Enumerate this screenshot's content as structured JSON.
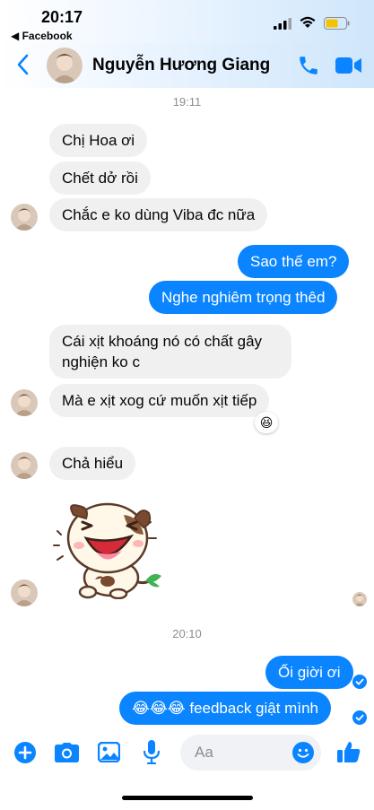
{
  "status_bar": {
    "time": "20:17",
    "back_app": "◀ Facebook"
  },
  "header": {
    "contact_name": "Nguyễn Hương Giang"
  },
  "timestamps": [
    "19:11",
    "20:10"
  ],
  "messages": {
    "m1": "Chị Hoa ơi",
    "m2": "Chết dở rồi",
    "m3": "Chắc e ko dùng Viba đc nữa",
    "m4": "Sao thế em?",
    "m5": "Nghe nghiêm trọng thêd",
    "m6_line1": "Cái xịt khoáng nó có chất gây",
    "m6_line2": "nghiện ko c",
    "m7": "Mà e xịt xog cứ muốn xịt tiếp",
    "m8": "Chả hiểu",
    "m9": "Ối giời ơi",
    "m10_emojis": "😂😂😂",
    "m10_text": "feedback giật mình"
  },
  "reaction": "😆",
  "composer": {
    "placeholder": "Aa"
  },
  "colors": {
    "accent": "#0a84ff",
    "incoming": "#f0f0f0"
  }
}
